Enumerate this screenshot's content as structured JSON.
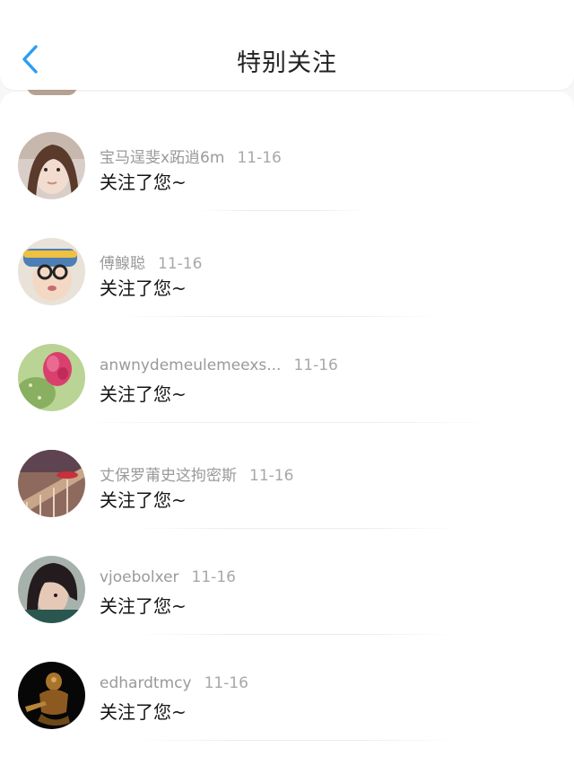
{
  "header": {
    "title": "特别关注",
    "back_icon": "chevron-left-icon",
    "accent_color": "#2a9df4"
  },
  "notifications": [
    {
      "username": "宝马逞斐x跖逍6m",
      "time": "11-16",
      "message": "关注了您~",
      "avatar": "girl-portrait"
    },
    {
      "username": "傅鳈聪",
      "time": "11-16",
      "message": "关注了您~",
      "avatar": "boy-with-glasses"
    },
    {
      "username": "anwnydemeulemeexs...",
      "time": "11-16",
      "message": "关注了您~",
      "avatar": "pink-flower"
    },
    {
      "username": "丈保罗莆史这拘密斯",
      "time": "11-16",
      "message": "关注了您~",
      "avatar": "wooden-rail"
    },
    {
      "username": "vjoebolxer",
      "time": "11-16",
      "message": "关注了您~",
      "avatar": "dark-hair-portrait"
    },
    {
      "username": "edhardtmcy",
      "time": "11-16",
      "message": "关注了您~",
      "avatar": "golden-statue"
    }
  ]
}
